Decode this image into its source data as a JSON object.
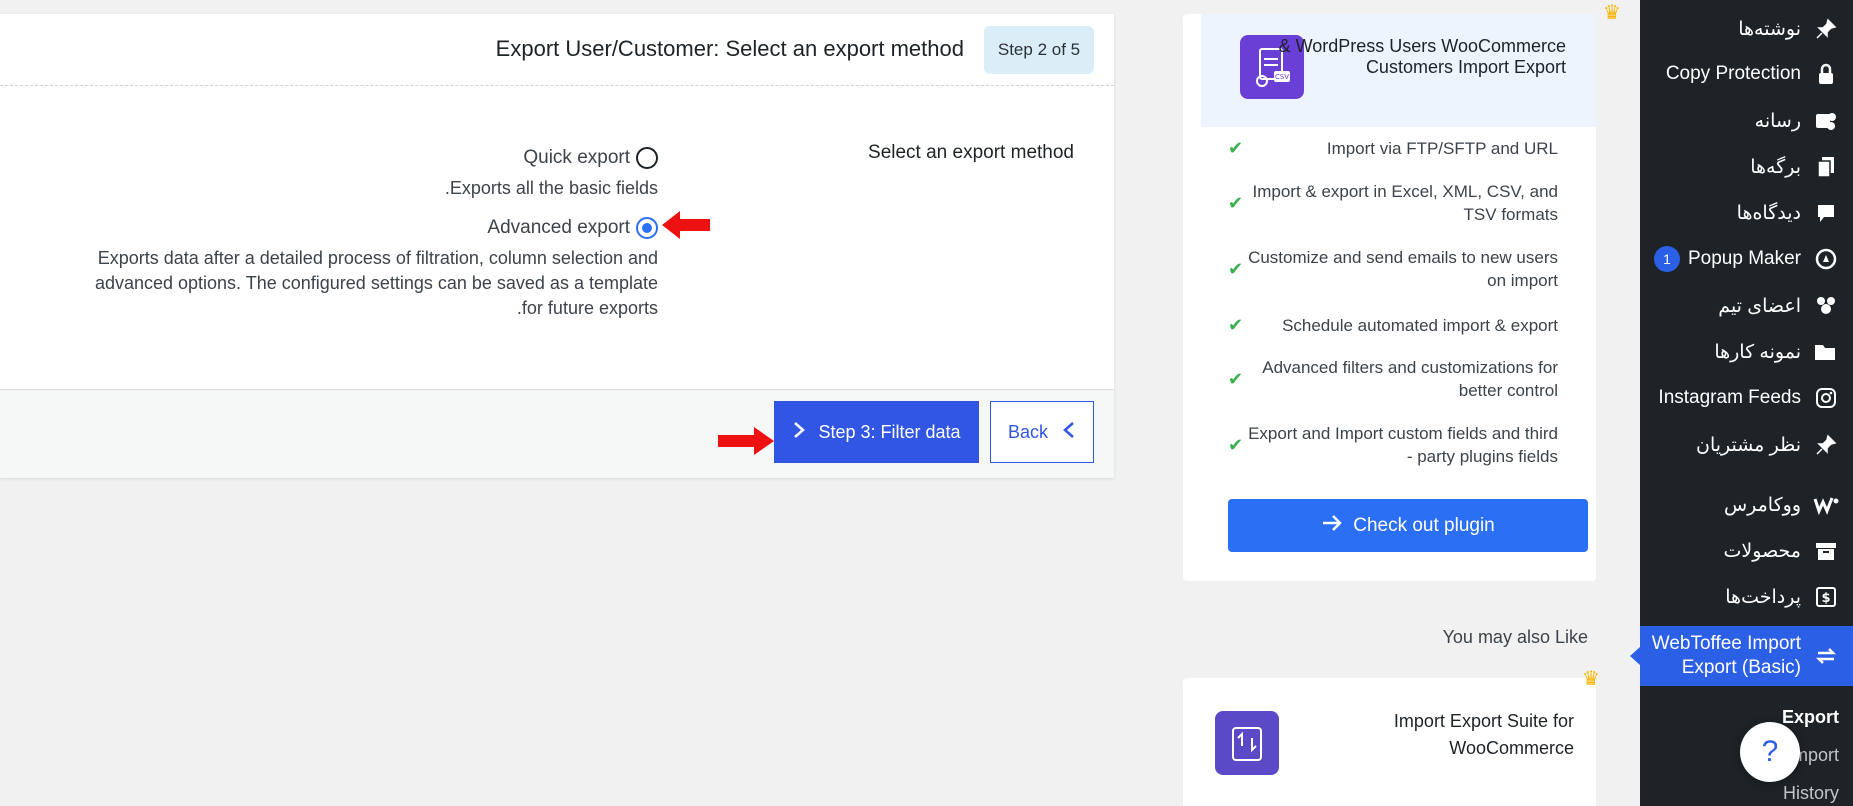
{
  "sidebar": {
    "items": [
      {
        "label": "نوشته‌ها",
        "icon": "pin-icon"
      },
      {
        "label": "Copy Protection",
        "icon": "lock-icon"
      },
      {
        "label": "رسانه",
        "icon": "media-icon"
      },
      {
        "label": "برگه‌ها",
        "icon": "pages-icon"
      },
      {
        "label": "دیدگاه‌ها",
        "icon": "comment-icon"
      },
      {
        "label": "Popup Maker",
        "icon": "popup-icon",
        "badge": "1"
      },
      {
        "label": "اعضای تیم",
        "icon": "team-icon"
      },
      {
        "label": "نمونه کارها",
        "icon": "folder-icon"
      },
      {
        "label": "Instagram Feeds",
        "icon": "instagram-icon"
      },
      {
        "label": "نظر مشتریان",
        "icon": "pin-icon"
      },
      {
        "label": "ووکامرس",
        "icon": "woocommerce-icon"
      },
      {
        "label": "محصولات",
        "icon": "archive-icon"
      },
      {
        "label": "پرداخت‌ها",
        "icon": "dollar-icon"
      },
      {
        "label": "WebToffee Import Export (Basic)",
        "icon": "import-export-icon"
      }
    ],
    "submenu": [
      "Export",
      "Import",
      "History"
    ],
    "help": "?"
  },
  "promo": {
    "title": "& WordPress Users WooCommerce Customers Import Export",
    "features": [
      "Import via FTP/SFTP and URL",
      "Import & export in Excel, XML, CSV, and TSV formats",
      "Customize and send emails to new users on import",
      "Schedule automated import & export",
      "Advanced filters and customizations for better control",
      "Export and Import custom fields and third - party plugins fields"
    ],
    "checkout_label": "Check out plugin",
    "also_like": "You may also Like",
    "suite_title": "Import Export Suite for WooCommerce"
  },
  "wizard": {
    "title": "Export User/Customer: Select an export method",
    "step": "Step 2 of 5",
    "method_label": "Select an export method",
    "options": [
      {
        "label": "Quick export",
        "desc": ".Exports all the basic fields",
        "selected": false
      },
      {
        "label": "Advanced export",
        "desc_lines": [
          "Exports data after a detailed process of filtration, column selection and",
          "advanced options. The configured settings can be saved as a template",
          ".for future exports"
        ],
        "selected": true
      }
    ],
    "next_label": "Step 3: Filter data",
    "back_label": "Back"
  },
  "colors": {
    "accent": "#3156e3",
    "sidebar_bg": "#1d2327",
    "arrow": "#ee1111",
    "check": "#3cb04f"
  }
}
